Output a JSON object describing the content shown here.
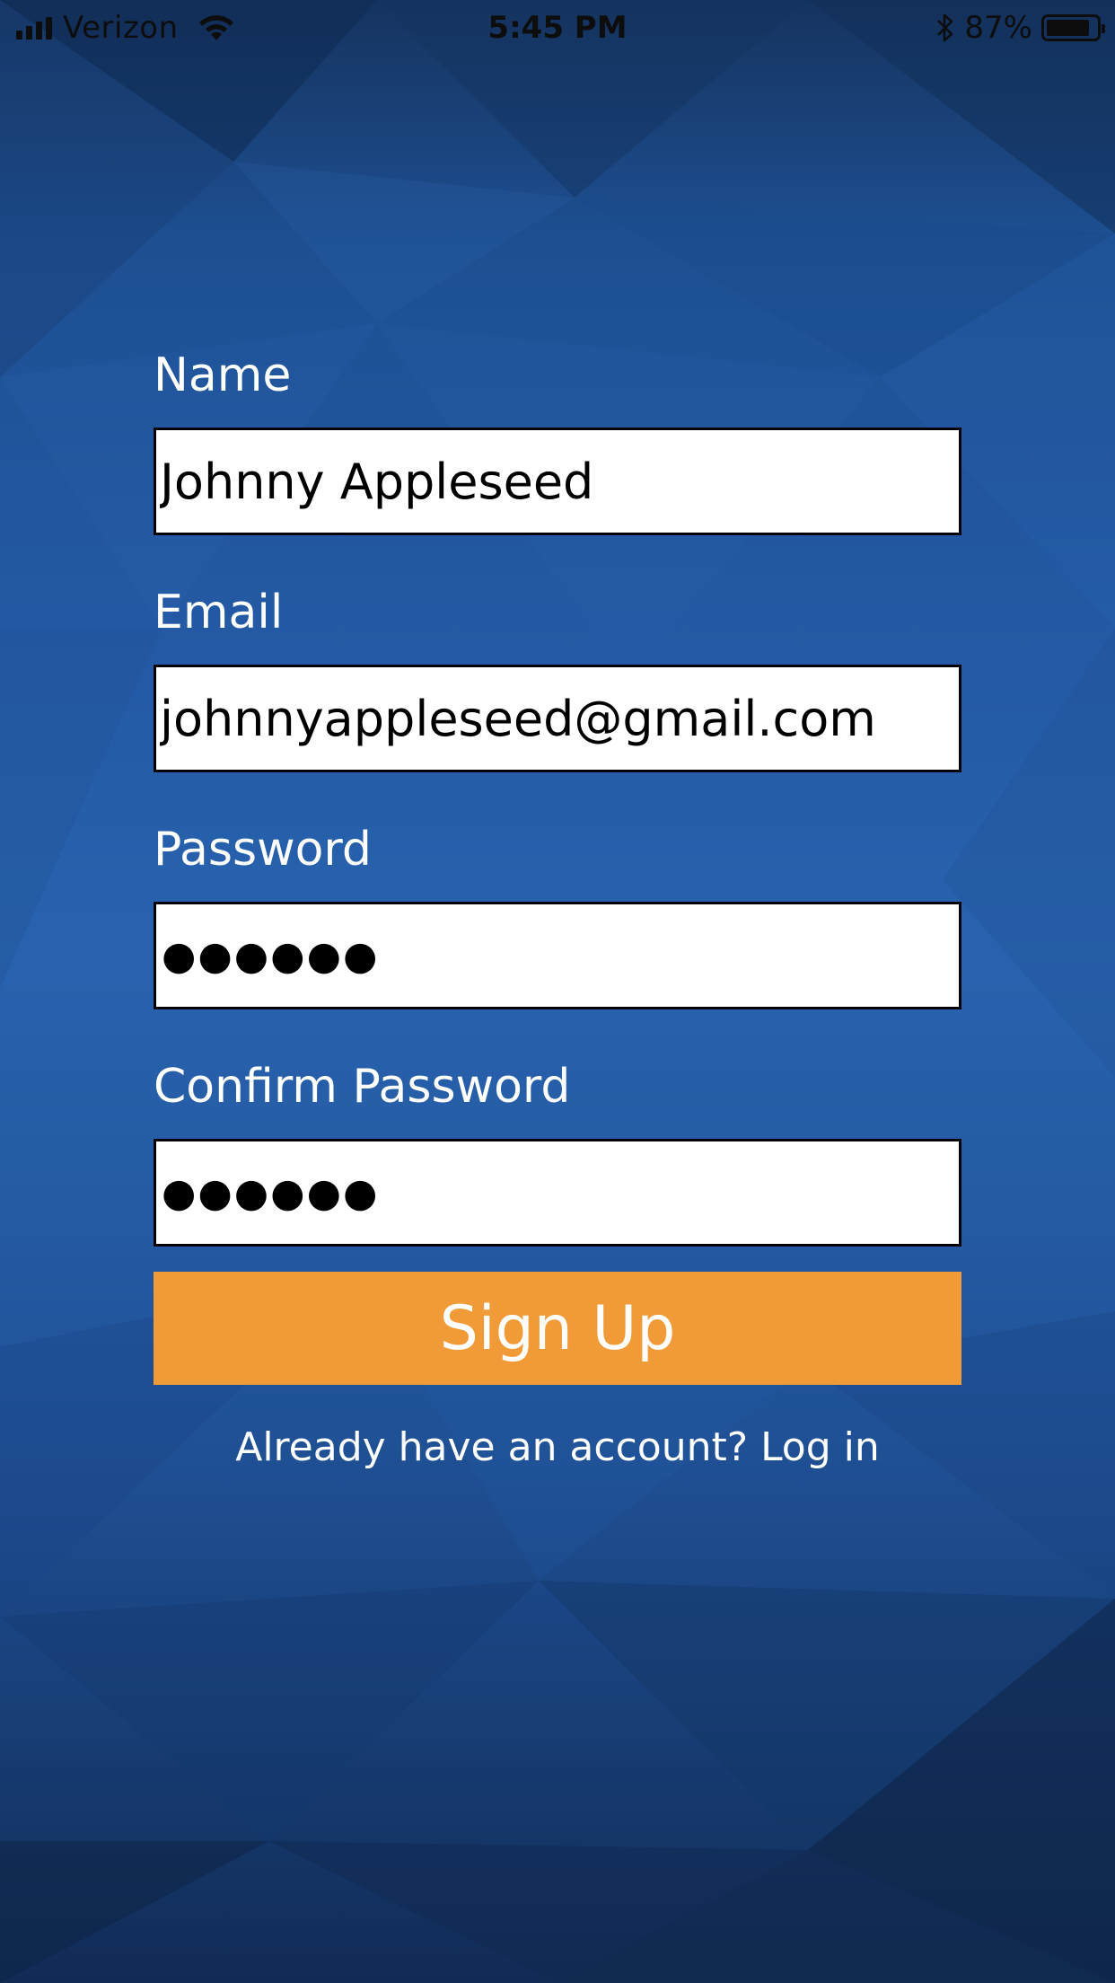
{
  "status_bar": {
    "carrier": "Verizon",
    "time": "5:45 PM",
    "battery_percent": "87%",
    "battery_level": 0.87,
    "icons": [
      "signal-bars-icon",
      "wifi-icon",
      "bluetooth-icon",
      "battery-icon"
    ]
  },
  "form": {
    "name_label": "Name",
    "name_value": "Johnny Appleseed",
    "email_label": "Email",
    "email_value": "johnnyappleseed@gmail.com",
    "password_label": "Password",
    "password_value": "●●●●●●",
    "confirm_label": "Confirm Password",
    "confirm_value": "●●●●●●"
  },
  "signup_button": {
    "label": "Sign Up"
  },
  "login_link": {
    "text": "Already have an account? Log in"
  },
  "colors": {
    "background": "#2358a3",
    "button": "#f19a38",
    "field_border": "#000000",
    "label_text": "#ffffff"
  }
}
